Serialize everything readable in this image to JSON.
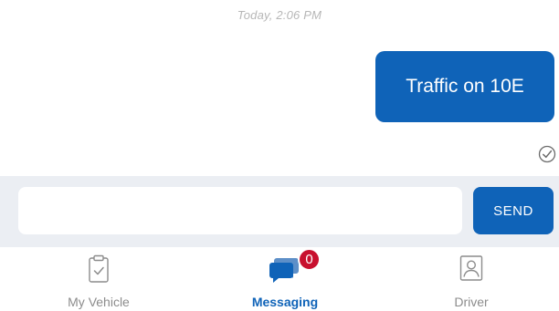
{
  "conversation": {
    "timestamp": "Today, 2:06 PM",
    "messages": [
      {
        "text": "Traffic on 10E",
        "direction": "outgoing",
        "status": "delivered"
      }
    ]
  },
  "composer": {
    "input_value": "",
    "input_placeholder": "",
    "send_label": "SEND"
  },
  "tabbar": {
    "tabs": [
      {
        "label": "My Vehicle",
        "icon": "clipboard-check-icon",
        "active": false
      },
      {
        "label": "Messaging",
        "icon": "chat-bubbles-icon",
        "active": true,
        "badge": "0"
      },
      {
        "label": "Driver",
        "icon": "driver-id-icon",
        "active": false
      }
    ]
  },
  "colors": {
    "accent": "#0f63b8",
    "badge": "#c8102e",
    "composer_bg": "#ebeef3",
    "inactive_text": "#8c8c8c",
    "timestamp_text": "#b7b7b7"
  }
}
